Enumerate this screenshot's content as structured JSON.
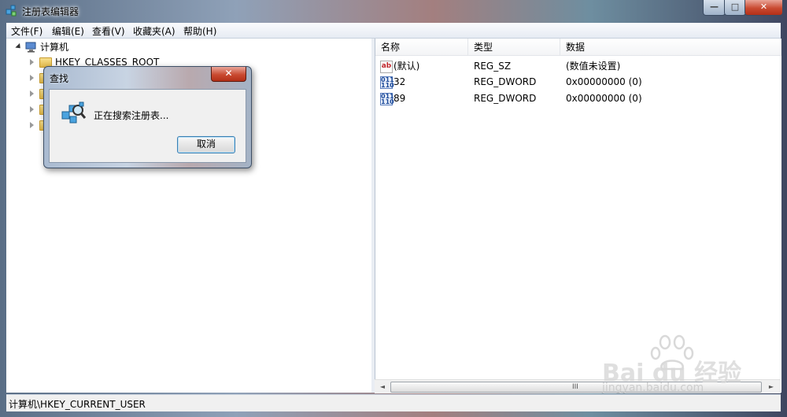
{
  "window": {
    "title": "注册表编辑器",
    "min_label": "—",
    "max_label": "□",
    "close_label": "✕"
  },
  "menu": {
    "items": [
      "文件(F)",
      "编辑(E)",
      "查看(V)",
      "收藏夹(A)",
      "帮助(H)"
    ]
  },
  "tree": {
    "root": "计算机",
    "children": [
      "HKEY_CLASSES_ROOT",
      "",
      "",
      "",
      ""
    ]
  },
  "list": {
    "columns": [
      "名称",
      "类型",
      "数据"
    ],
    "rows": [
      {
        "icon": "string-value-icon",
        "icon_text": "ab",
        "name": "(默认)",
        "type": "REG_SZ",
        "data": "(数值未设置)"
      },
      {
        "icon": "binary-value-icon",
        "icon_text": "011\n110",
        "name": "32",
        "type": "REG_DWORD",
        "data": "0x00000000 (0)"
      },
      {
        "icon": "binary-value-icon",
        "icon_text": "011\n110",
        "name": "89",
        "type": "REG_DWORD",
        "data": "0x00000000 (0)"
      }
    ]
  },
  "status": {
    "path": "计算机\\HKEY_CURRENT_USER"
  },
  "dialog": {
    "title": "查找",
    "close_label": "✕",
    "message": "正在搜索注册表...",
    "cancel_label": "取消"
  },
  "watermark": {
    "brand": "Bai du 经验",
    "url": "jingyan.baidu.com"
  },
  "scrollbar": {
    "grip": "III",
    "left_arrow": "◄",
    "right_arrow": "►"
  }
}
